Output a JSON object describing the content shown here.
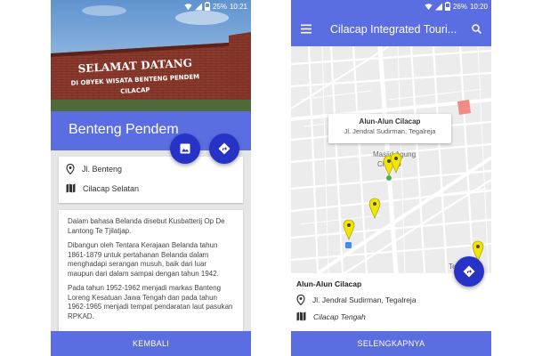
{
  "left_screen": {
    "status": {
      "battery": "25%",
      "time": "10:21"
    },
    "header_image": {
      "sign_line1": "SELAMAT DATANG",
      "sign_line2": "DI OBYEK WISATA BENTENG PENDEM",
      "sign_line3": "CILACAP"
    },
    "place_title": "Benteng Pendem",
    "address_icon": "location-pin-icon",
    "address": "Jl. Benteng",
    "region_icon": "map-icon",
    "region": "Cilacap Selatan",
    "gallery_icon": "image-icon",
    "directions_icon": "directions-icon",
    "description": [
      "Dalam bahasa Belanda disebut Kusbatterij Op De Lantong Te Tjilatjap.",
      "Dibangun oleh Tentara Kerajaan Belanda tahun 1861-1879 untuk pertahanan Belanda dalam menghadapi serangan musuh, baik dari luar maupun dari dalam sampai dengan tahun 1942.",
      "Pada tahun 1952-1962 menjadi markas Banteng Loreng Kesatuan Jawa Tengah dan pada tahun 1962-1965 menjadi tempat pendaratan laut pasukan RPKAD."
    ],
    "back_button": "KEMBALI"
  },
  "right_screen": {
    "status": {
      "battery": "26%",
      "time": "10:20"
    },
    "app_title": "Cilacap Integrated Touri...",
    "menu_icon": "hamburger-menu-icon",
    "search_icon": "search-icon",
    "map": {
      "labels": {
        "masjid": "Masjid Agung",
        "cilacap": "Cilacap",
        "teluk": "Teluk P"
      },
      "info_window": {
        "title": "Alun-Alun Cilacap",
        "address": "Jl. Jendral Sudirman, Tegalreja"
      },
      "marker_color": "#f2e500",
      "highlight_color": "#f28b82"
    },
    "selected_place": {
      "title": "Alun-Alun Cilacap",
      "address": "Jl. Jendral Sudirman, Tegalreja",
      "region": "Cilacap Tengah"
    },
    "more_button": "SELENGKAPNYA"
  },
  "colors": {
    "primary": "#5b6ee1",
    "fab": "#2733c6"
  }
}
